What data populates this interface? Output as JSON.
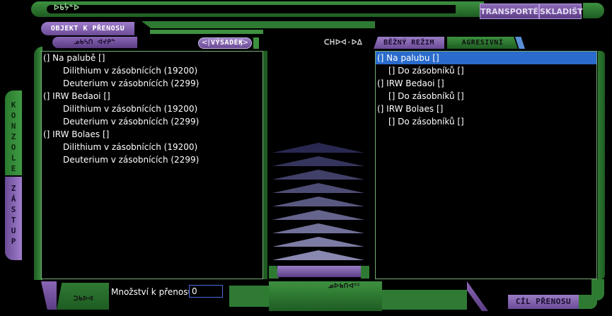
{
  "header": {
    "title_glyph": "ᐅᑲᔮᓐᐅ",
    "tab_transporter": "TRANSPORTÉR",
    "tab_skladiste": "SKLADIŠTĚ"
  },
  "left": {
    "object_tab": "OBJEKT K PŘENOSU",
    "object_sub_glyph": "ᓄᑲᓴᑎ ᐊᔪᑭᓐ",
    "vysadek_label": "VÝSADEK",
    "side_tab_konzole": "KONZOLE",
    "side_tab_zastup": "ZÁSTUP",
    "items": [
      {
        "label": "(] Na palubě []",
        "level": 1
      },
      {
        "label": "Dilithium v zásobnících (19200)",
        "level": 2
      },
      {
        "label": "Deuterium v zásobnících (2299)",
        "level": 2
      },
      {
        "label": "(] IRW Bedaoi []",
        "level": 1
      },
      {
        "label": "Dilithium v zásobnících (19200)",
        "level": 2
      },
      {
        "label": "Deuterium v zásobnících (2299)",
        "level": 2
      },
      {
        "label": "(] IRW Bolaes []",
        "level": 1
      },
      {
        "label": "Dilithium v zásobnících (19200)",
        "level": 2
      },
      {
        "label": "Deuterium v zásobnících (2299)",
        "level": 2
      }
    ]
  },
  "right": {
    "center_glyph": "ᑕᕼᐅᐊ·ᐅᐃ",
    "mode_normal": "BĚŽNÝ REŽIM",
    "mode_aggressive": "AGRESIVNÍ",
    "items": [
      {
        "label": "(] Na palubu []",
        "level": 1,
        "selected": true
      },
      {
        "label": "[] Do zásobníků []",
        "level": 2
      },
      {
        "label": "(] IRW Bedaoi []",
        "level": 1
      },
      {
        "label": "[] Do zásobníků []",
        "level": 2
      },
      {
        "label": "(] IRW Bolaes []",
        "level": 1
      },
      {
        "label": "[] Do zásobníků []",
        "level": 2
      }
    ]
  },
  "footer": {
    "amount_label": "Množství k přenosu:",
    "amount_value": "0",
    "left_glyph": "ᑐᑲᐅᐊ",
    "center_glyph": "ᓄᐅᑲᑎᐊᑦᑦ",
    "target_label": "CÍL PŘENOSU"
  }
}
